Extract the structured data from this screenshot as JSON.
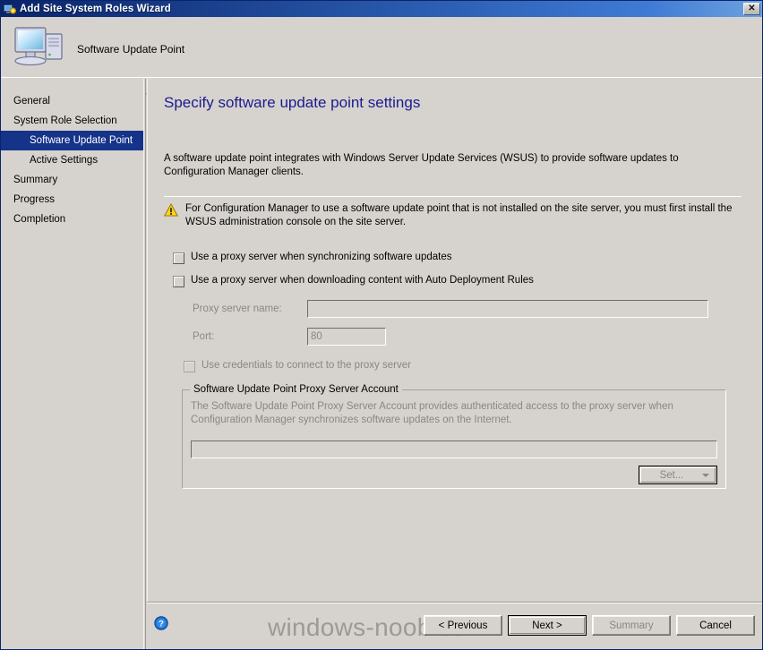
{
  "window": {
    "title": "Add Site System Roles Wizard",
    "title_icon": "site-system-icon",
    "close_label": "✕"
  },
  "header": {
    "icon": "computer-icon",
    "title": "Software Update Point"
  },
  "sidebar": {
    "items": [
      {
        "label": "General",
        "selected": false,
        "sub": false
      },
      {
        "label": "System Role Selection",
        "selected": false,
        "sub": false
      },
      {
        "label": "Software Update Point",
        "selected": true,
        "sub": true
      },
      {
        "label": "Active Settings",
        "selected": false,
        "sub": true
      },
      {
        "label": "Summary",
        "selected": false,
        "sub": false
      },
      {
        "label": "Progress",
        "selected": false,
        "sub": false
      },
      {
        "label": "Completion",
        "selected": false,
        "sub": false
      }
    ]
  },
  "main": {
    "page_title": "Specify software update point settings",
    "intro": "A software update point integrates with Windows Server Update Services (WSUS) to provide software updates to Configuration Manager clients.",
    "warning": {
      "icon": "warning-triangle-icon",
      "text": "For Configuration Manager to use a software update point that is not installed on the site server, you must first install the WSUS administration console on the site server."
    },
    "checkboxes": [
      {
        "label": "Use a proxy server when synchronizing software updates",
        "checked": false,
        "disabled": false
      },
      {
        "label": "Use a proxy server when downloading content with Auto Deployment Rules",
        "checked": false,
        "disabled": false
      },
      {
        "label": "Use credentials to connect to the proxy server",
        "checked": false,
        "disabled": true
      }
    ],
    "proxy_name": {
      "label": "Proxy server name:",
      "value": "",
      "placeholder": ""
    },
    "proxy_port": {
      "label": "Port:",
      "value": "80"
    },
    "groupbox": {
      "legend": "Software Update Point Proxy Server Account",
      "description": "The Software Update Point Proxy Server Account provides  authenticated access to the proxy server when Configuration Manager synchronizes software updates on the Internet.",
      "account_value": "",
      "set_button": "Set...",
      "set_arrow_icon": "chevron-down-icon"
    }
  },
  "footer": {
    "help_icon": "help-circle-icon",
    "watermark": "windows-noob.com",
    "buttons": [
      {
        "label": "< Previous",
        "disabled": false,
        "default": false
      },
      {
        "label": "Next >",
        "disabled": false,
        "default": true
      },
      {
        "label": "Summary",
        "disabled": true,
        "default": false
      },
      {
        "label": "Cancel",
        "disabled": false,
        "default": false
      }
    ]
  },
  "colors": {
    "titlebar_start": "#0a246a",
    "titlebar_end": "#6ea2e0",
    "face": "#d6d3ce",
    "selection": "#16338a",
    "heading": "#1b1b8f",
    "disabled_text": "#8a8781",
    "warning_yellow": "#f5c518"
  }
}
